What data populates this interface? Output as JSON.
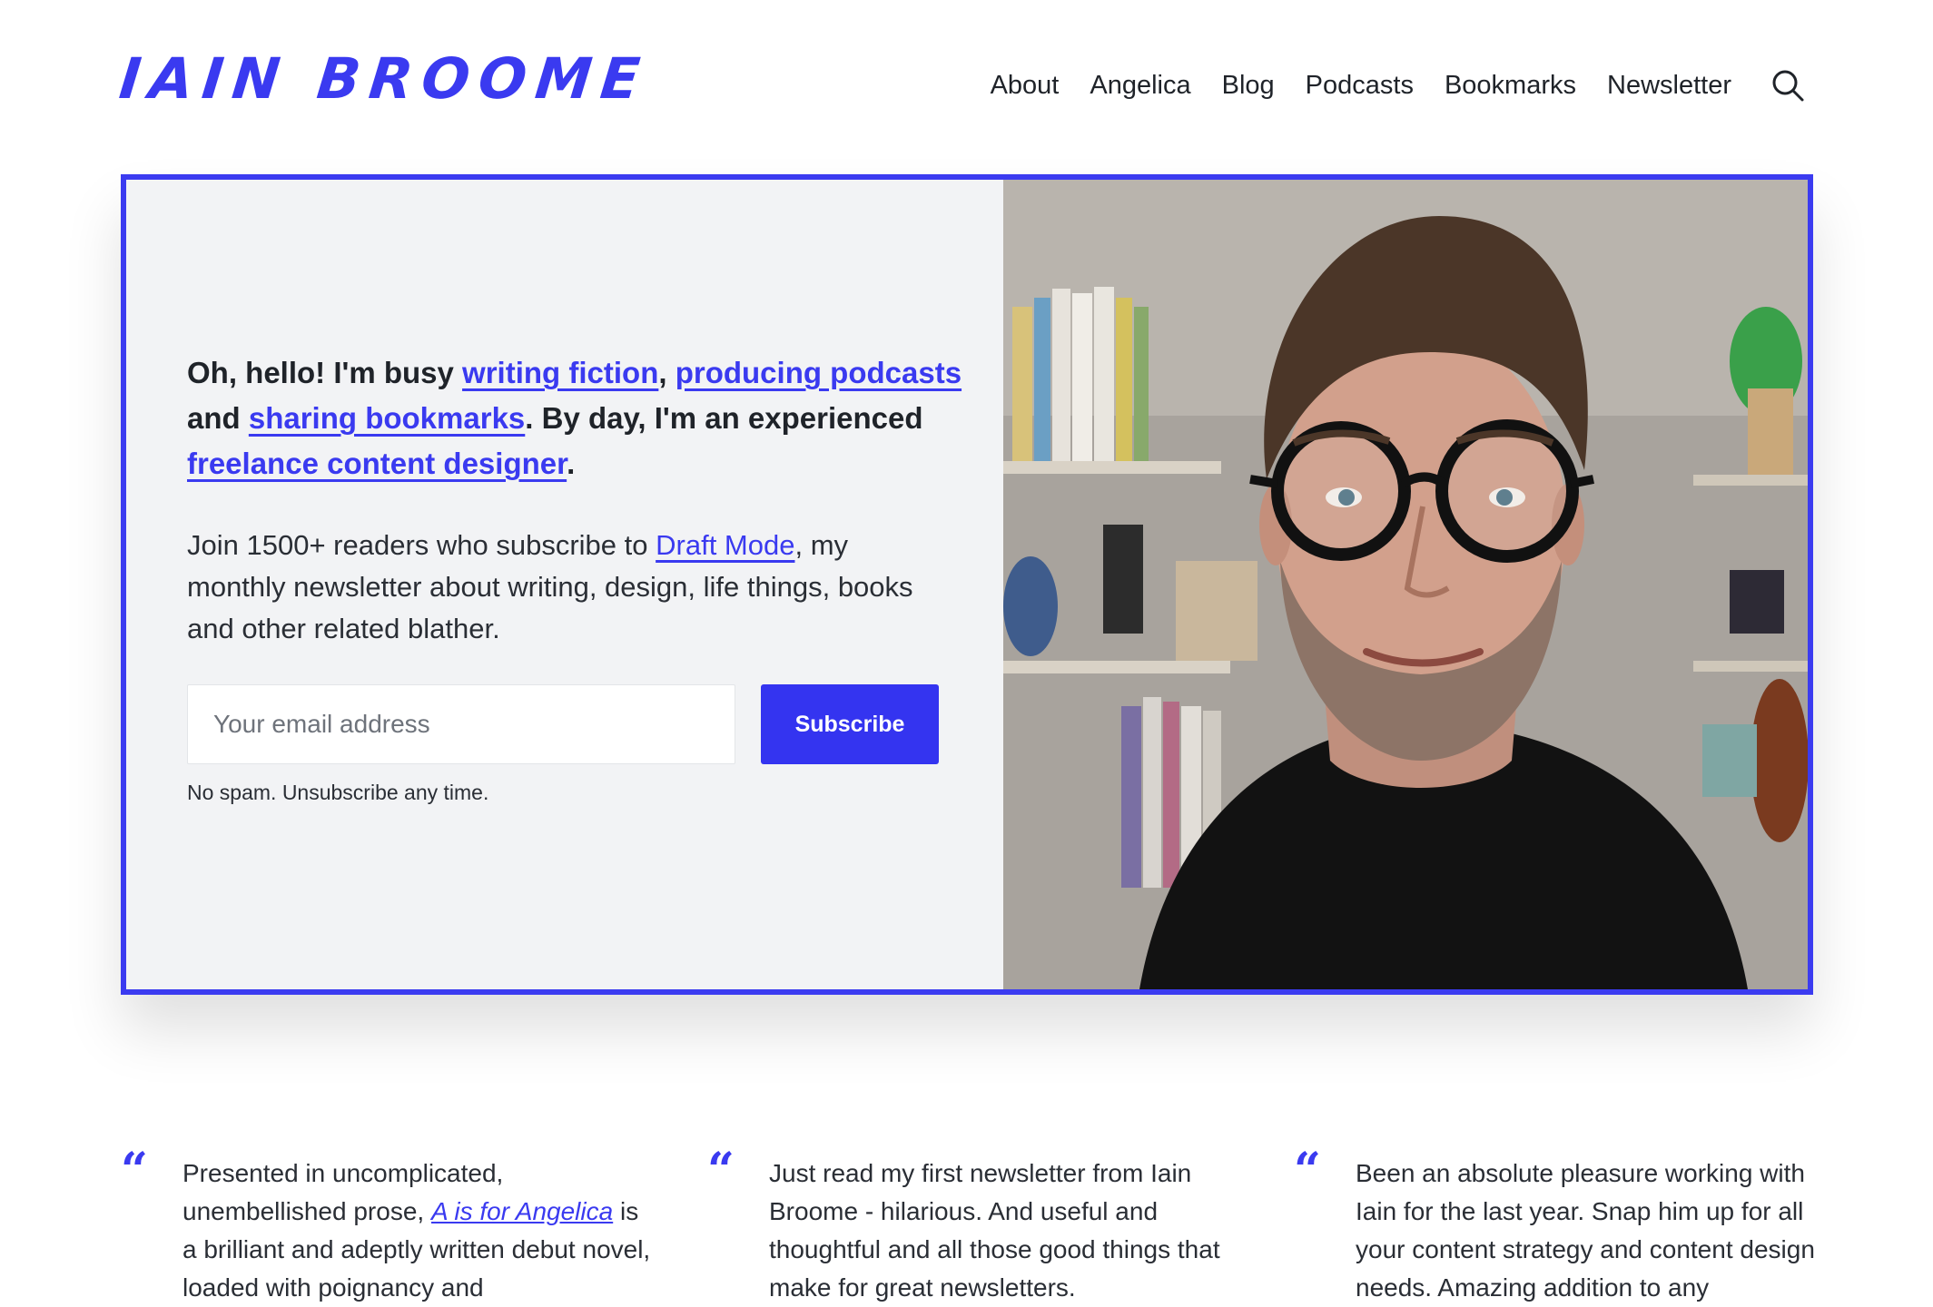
{
  "brand": {
    "logo_text": "IAIN BROOME",
    "accent": "#3a3af0"
  },
  "nav": {
    "items": [
      "About",
      "Angelica",
      "Blog",
      "Podcasts",
      "Bookmarks",
      "Newsletter"
    ],
    "search_icon": "search-icon"
  },
  "hero": {
    "intro": {
      "lead": "Oh, hello! I'm busy ",
      "link_fiction": "writing fiction",
      "sep1": ", ",
      "link_podcasts": "producing podcasts",
      "and": " and ",
      "link_bookmarks": "sharing bookmarks",
      "mid": ". By day, I'm an experienced ",
      "link_designer": "freelance content designer",
      "end": "."
    },
    "blurb": {
      "lead": "Join 1500+ readers who subscribe to ",
      "link_newsletter": "Draft Mode",
      "rest": ", my monthly newsletter about writing, design, life things, books and other related blather."
    },
    "form": {
      "email_placeholder": "Your email address",
      "email_value": "",
      "subscribe_label": "Subscribe",
      "fineprint": "No spam. Unsubscribe any time."
    },
    "portrait_alt": "Photo of Iain Broome"
  },
  "testimonials": [
    {
      "lead": "Presented in uncomplicated, unembellished prose, ",
      "link": "A is for Angelica",
      "rest": " is a brilliant and adeptly written debut novel, loaded with poignancy and"
    },
    {
      "lead": "Just read my first newsletter from Iain Broome - hilarious. And useful and thoughtful and all those good things that make for great newsletters.",
      "link": "",
      "rest": ""
    },
    {
      "lead": "Been an absolute pleasure working with Iain for the last year. Snap him up for all your content strategy and content design needs. Amazing addition to any",
      "link": "",
      "rest": ""
    }
  ]
}
